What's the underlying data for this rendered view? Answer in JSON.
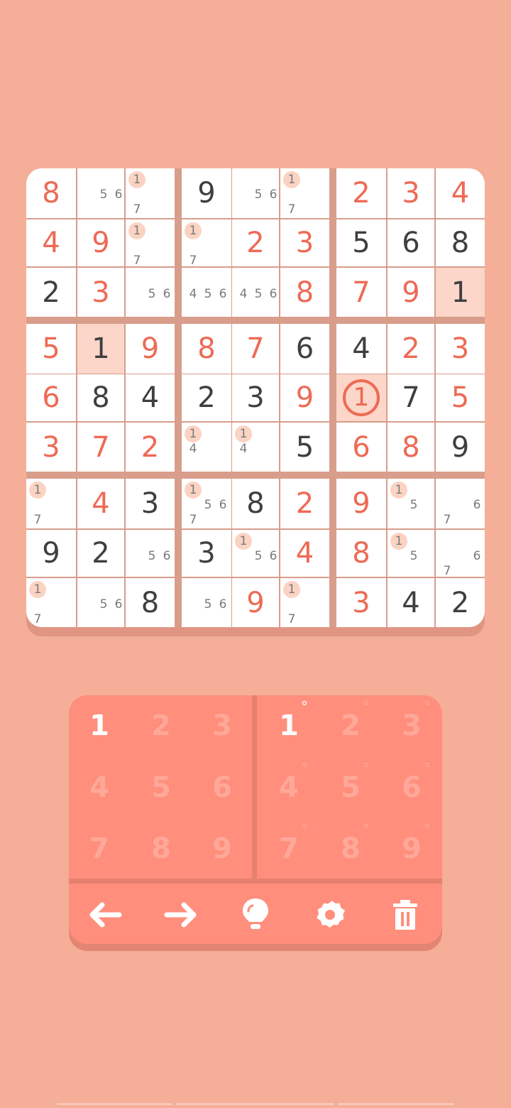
{
  "colors": {
    "background": "#f5ae98",
    "given_digit": "#3f3f3f",
    "user_digit": "#ee6a55",
    "highlight_cell": "#fcd6c8",
    "note_flag": "#fbd3c3",
    "keypad": "#ff8e7c"
  },
  "board": {
    "cells": [
      [
        {
          "v": "8",
          "t": "user"
        },
        {
          "notes": [
            {
              "d": "5",
              "p": 4
            },
            {
              "d": "6",
              "p": 5
            }
          ]
        },
        {
          "notes": [
            {
              "d": "1",
              "p": 0,
              "f": 1
            },
            {
              "d": "7",
              "p": 6
            }
          ]
        },
        {
          "v": "9",
          "t": "given"
        },
        {
          "notes": [
            {
              "d": "5",
              "p": 4
            },
            {
              "d": "6",
              "p": 5
            }
          ]
        },
        {
          "notes": [
            {
              "d": "1",
              "p": 0,
              "f": 1
            },
            {
              "d": "7",
              "p": 6
            }
          ]
        },
        {
          "v": "2",
          "t": "user"
        },
        {
          "v": "3",
          "t": "user"
        },
        {
          "v": "4",
          "t": "user"
        }
      ],
      [
        {
          "v": "4",
          "t": "user"
        },
        {
          "v": "9",
          "t": "user"
        },
        {
          "notes": [
            {
              "d": "1",
              "p": 0,
              "f": 1
            },
            {
              "d": "7",
              "p": 6
            }
          ]
        },
        {
          "notes": [
            {
              "d": "1",
              "p": 0,
              "f": 1
            },
            {
              "d": "7",
              "p": 6
            }
          ]
        },
        {
          "v": "2",
          "t": "user"
        },
        {
          "v": "3",
          "t": "user"
        },
        {
          "v": "5",
          "t": "given"
        },
        {
          "v": "6",
          "t": "given"
        },
        {
          "v": "8",
          "t": "given"
        }
      ],
      [
        {
          "v": "2",
          "t": "given"
        },
        {
          "v": "3",
          "t": "user"
        },
        {
          "notes": [
            {
              "d": "5",
              "p": 4
            },
            {
              "d": "6",
              "p": 5
            }
          ]
        },
        {
          "notes": [
            {
              "d": "4",
              "p": 3
            },
            {
              "d": "5",
              "p": 4
            },
            {
              "d": "6",
              "p": 5
            }
          ]
        },
        {
          "notes": [
            {
              "d": "4",
              "p": 3
            },
            {
              "d": "5",
              "p": 4
            },
            {
              "d": "6",
              "p": 5
            }
          ]
        },
        {
          "v": "8",
          "t": "user"
        },
        {
          "v": "7",
          "t": "user"
        },
        {
          "v": "9",
          "t": "user"
        },
        {
          "v": "1",
          "t": "given",
          "hl": true
        }
      ],
      [
        {
          "v": "5",
          "t": "user"
        },
        {
          "v": "1",
          "t": "given",
          "hl": true
        },
        {
          "v": "9",
          "t": "user"
        },
        {
          "v": "8",
          "t": "user"
        },
        {
          "v": "7",
          "t": "user"
        },
        {
          "v": "6",
          "t": "given"
        },
        {
          "v": "4",
          "t": "given"
        },
        {
          "v": "2",
          "t": "user"
        },
        {
          "v": "3",
          "t": "user"
        }
      ],
      [
        {
          "v": "6",
          "t": "user"
        },
        {
          "v": "8",
          "t": "given"
        },
        {
          "v": "4",
          "t": "given"
        },
        {
          "v": "2",
          "t": "given"
        },
        {
          "v": "3",
          "t": "given"
        },
        {
          "v": "9",
          "t": "user"
        },
        {
          "v": "1",
          "t": "circled",
          "hl": true
        },
        {
          "v": "7",
          "t": "given"
        },
        {
          "v": "5",
          "t": "user"
        }
      ],
      [
        {
          "v": "3",
          "t": "user"
        },
        {
          "v": "7",
          "t": "user"
        },
        {
          "v": "2",
          "t": "user"
        },
        {
          "notes": [
            {
              "d": "1",
              "p": 0,
              "f": 1
            },
            {
              "d": "4",
              "p": 3
            }
          ]
        },
        {
          "notes": [
            {
              "d": "1",
              "p": 0,
              "f": 1
            },
            {
              "d": "4",
              "p": 3
            }
          ]
        },
        {
          "v": "5",
          "t": "given"
        },
        {
          "v": "6",
          "t": "user"
        },
        {
          "v": "8",
          "t": "user"
        },
        {
          "v": "9",
          "t": "given"
        }
      ],
      [
        {
          "notes": [
            {
              "d": "1",
              "p": 0,
              "f": 1
            },
            {
              "d": "7",
              "p": 6
            }
          ]
        },
        {
          "v": "4",
          "t": "user"
        },
        {
          "v": "3",
          "t": "given"
        },
        {
          "notes": [
            {
              "d": "1",
              "p": 0,
              "f": 1
            },
            {
              "d": "5",
              "p": 4
            },
            {
              "d": "6",
              "p": 5
            },
            {
              "d": "7",
              "p": 6
            }
          ]
        },
        {
          "v": "8",
          "t": "given"
        },
        {
          "v": "2",
          "t": "user"
        },
        {
          "v": "9",
          "t": "user"
        },
        {
          "notes": [
            {
              "d": "1",
              "p": 0,
              "f": 1
            },
            {
              "d": "5",
              "p": 4
            }
          ]
        },
        {
          "notes": [
            {
              "d": "6",
              "p": 5
            },
            {
              "d": "7",
              "p": 6
            }
          ]
        }
      ],
      [
        {
          "v": "9",
          "t": "given"
        },
        {
          "v": "2",
          "t": "given"
        },
        {
          "notes": [
            {
              "d": "5",
              "p": 4
            },
            {
              "d": "6",
              "p": 5
            }
          ]
        },
        {
          "v": "3",
          "t": "given"
        },
        {
          "notes": [
            {
              "d": "1",
              "p": 0,
              "f": 1
            },
            {
              "d": "5",
              "p": 4
            },
            {
              "d": "6",
              "p": 5
            }
          ]
        },
        {
          "v": "4",
          "t": "user"
        },
        {
          "v": "8",
          "t": "user"
        },
        {
          "notes": [
            {
              "d": "1",
              "p": 0,
              "f": 1
            },
            {
              "d": "5",
              "p": 4
            }
          ]
        },
        {
          "notes": [
            {
              "d": "6",
              "p": 5
            },
            {
              "d": "7",
              "p": 6
            }
          ]
        }
      ],
      [
        {
          "notes": [
            {
              "d": "1",
              "p": 0,
              "f": 1
            },
            {
              "d": "7",
              "p": 6
            }
          ]
        },
        {
          "notes": [
            {
              "d": "5",
              "p": 4
            },
            {
              "d": "6",
              "p": 5
            }
          ]
        },
        {
          "v": "8",
          "t": "given"
        },
        {
          "notes": [
            {
              "d": "5",
              "p": 4
            },
            {
              "d": "6",
              "p": 5
            }
          ]
        },
        {
          "v": "9",
          "t": "user"
        },
        {
          "notes": [
            {
              "d": "1",
              "p": 0,
              "f": 1
            },
            {
              "d": "7",
              "p": 6
            }
          ]
        },
        {
          "v": "3",
          "t": "user"
        },
        {
          "v": "4",
          "t": "given"
        },
        {
          "v": "2",
          "t": "given"
        }
      ]
    ]
  },
  "keypad": {
    "value_keys": [
      "1",
      "2",
      "3",
      "4",
      "5",
      "6",
      "7",
      "8",
      "9"
    ],
    "note_keys": [
      "1",
      "2",
      "3",
      "4",
      "5",
      "6",
      "7",
      "8",
      "9"
    ],
    "note_marker": "°",
    "active_value": "1",
    "active_note": "1"
  },
  "toolbar": [
    "arrow-left-icon",
    "arrow-right-icon",
    "lightbulb-icon",
    "gear-icon",
    "trash-icon"
  ]
}
